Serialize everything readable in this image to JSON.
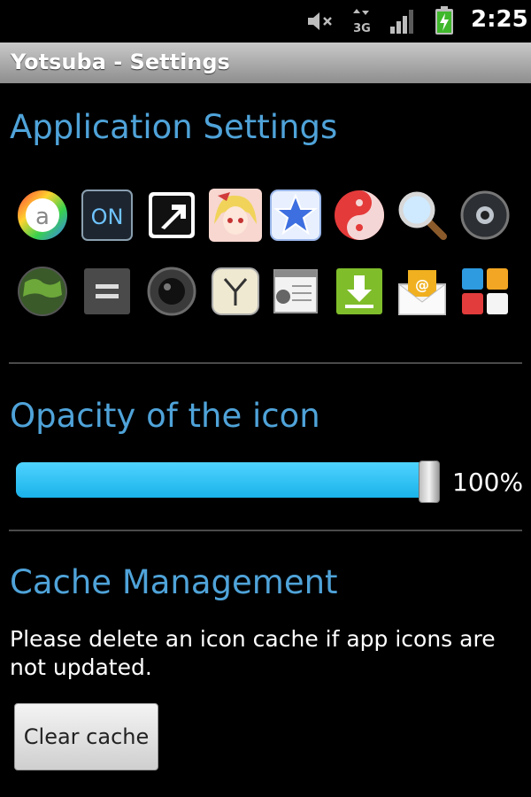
{
  "status_bar": {
    "time": "2:25",
    "icons": [
      "mute-icon",
      "data-3g-icon",
      "signal-icon",
      "battery-icon"
    ]
  },
  "title_bar": {
    "title": "Yotsuba - Settings"
  },
  "application_settings": {
    "heading": "Application Settings",
    "icons": [
      "aicon-icon",
      "on-switch-icon",
      "shortcut-arrow-icon",
      "anime-girl-icon",
      "star-icon",
      "yin-yang-icon",
      "magnifier-icon",
      "dark-button-icon",
      "globe-icon",
      "equals-icon",
      "camera-lens-icon",
      "clock-icon",
      "notebook-icon",
      "download-icon",
      "email-icon",
      "tiles-icon"
    ]
  },
  "opacity": {
    "heading": "Opacity of the icon",
    "value_percent": 100,
    "value_label": "100%"
  },
  "cache": {
    "heading": "Cache Management",
    "description": "Please delete an icon cache if app icons are not updated.",
    "button_label": "Clear cache"
  },
  "colors": {
    "accent": "#4fa3d9",
    "slider_fill": "#2ec4f5",
    "background": "#000000"
  }
}
